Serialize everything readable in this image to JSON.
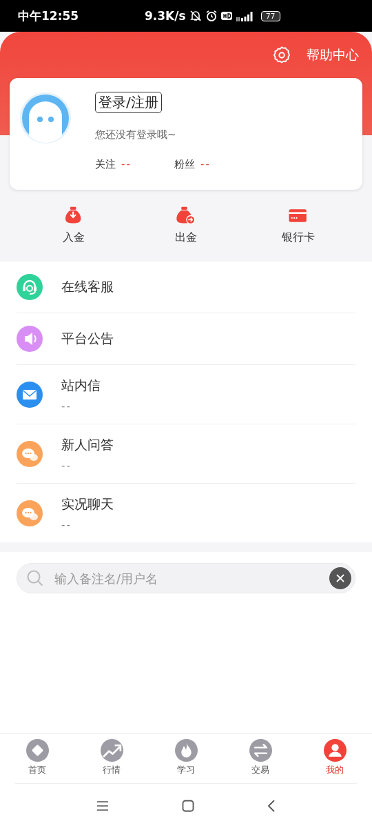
{
  "status_bar": {
    "time": "中午12:55",
    "speed": "9.3K/s",
    "battery": "77"
  },
  "header": {
    "help": "帮助中心"
  },
  "profile": {
    "login": "登录/注册",
    "subtitle": "您还没有登录哦~",
    "stats": [
      {
        "label": "关注",
        "value": "--"
      },
      {
        "label": "粉丝",
        "value": "--"
      }
    ]
  },
  "shortcuts": [
    {
      "kind": "deposit",
      "label": "入金"
    },
    {
      "kind": "withdraw",
      "label": "出金"
    },
    {
      "kind": "card",
      "label": "银行卡"
    }
  ],
  "menu": [
    {
      "kind": "headset",
      "color": "#2fd39a",
      "title": "在线客服"
    },
    {
      "kind": "speaker",
      "color": "#d88ef5",
      "title": "平台公告"
    },
    {
      "kind": "mail",
      "color": "#2b8ff0",
      "title": "站内信",
      "subtitle": "--"
    },
    {
      "kind": "chat",
      "color": "#fba35a",
      "title": "新人问答",
      "subtitle": "--"
    },
    {
      "kind": "chat",
      "color": "#fba35a",
      "title": "实况聊天",
      "subtitle": "--"
    }
  ],
  "search": {
    "placeholder": "输入备注名/用户名"
  },
  "tabs": [
    {
      "kind": "home",
      "label": "首页",
      "selected": false
    },
    {
      "kind": "market",
      "label": "行情",
      "selected": false
    },
    {
      "kind": "learn",
      "label": "学习",
      "selected": false
    },
    {
      "kind": "trade",
      "label": "交易",
      "selected": false
    },
    {
      "kind": "me",
      "label": "我的",
      "selected": true
    }
  ]
}
